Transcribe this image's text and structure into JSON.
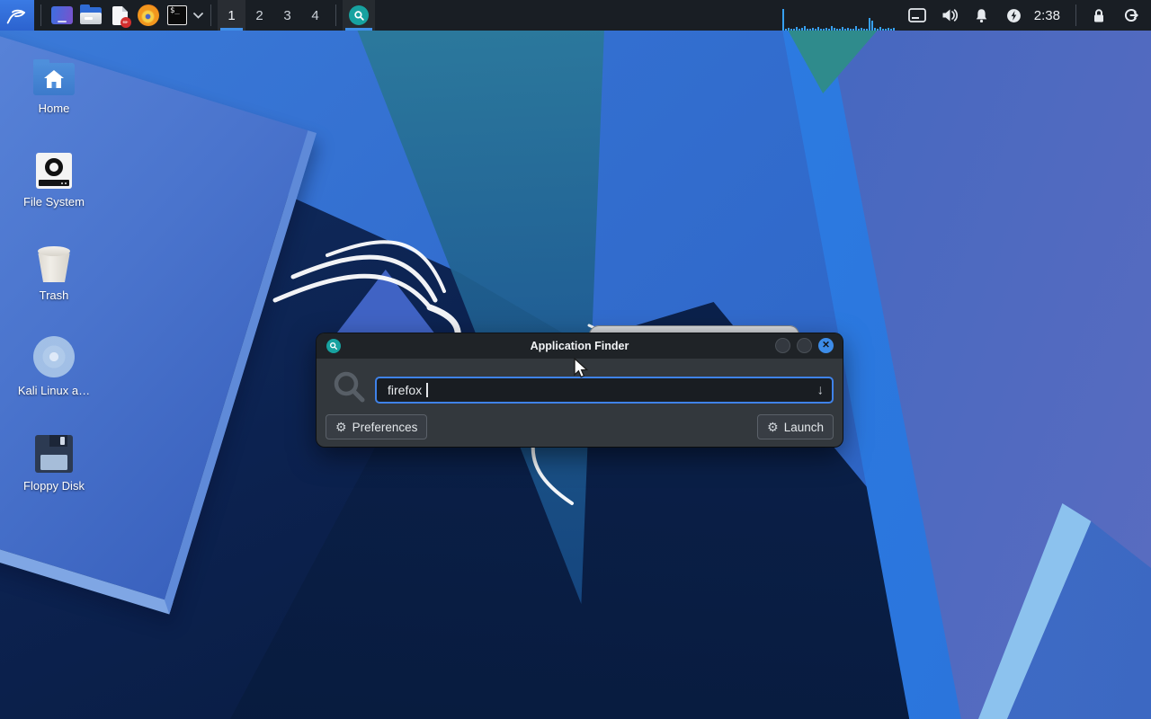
{
  "panel": {
    "colors": {
      "accent": "#3f8fe8",
      "panel_bg": "#191e24",
      "kali_blue": "#2c63cf"
    },
    "menu": {
      "icon": "kali-dragon-icon"
    },
    "launcher_icons": [
      "desktop-icon",
      "file-manager-icon",
      "text-editor-icon",
      "firefox-icon",
      "terminal-icon"
    ],
    "terminal_dropdown_icon": "chevron-down-icon",
    "workspaces": {
      "items": [
        "1",
        "2",
        "3",
        "4"
      ],
      "active": "1"
    },
    "taskbar": {
      "app": "application-finder",
      "icon": "app-finder-icon"
    },
    "cpu_graph_bars": [
      24,
      2,
      3,
      2,
      2,
      4,
      2,
      3,
      5,
      2,
      2,
      3,
      2,
      4,
      2,
      2,
      3,
      2,
      5,
      3,
      2,
      2,
      4,
      2,
      3,
      2,
      2,
      5,
      2,
      3,
      2,
      2,
      14,
      11,
      3,
      2,
      4,
      2,
      2,
      3,
      2,
      3
    ],
    "tray_icons": [
      "touchpad-icon",
      "volume-icon",
      "notification-bell-icon",
      "power-manager-icon"
    ],
    "clock": "2:38",
    "session_icons": [
      "lock-icon",
      "logout-icon"
    ]
  },
  "desktop_icons": [
    {
      "label": "Home",
      "icon": "home-folder-icon"
    },
    {
      "label": "File System",
      "icon": "drive-icon"
    },
    {
      "label": "Trash",
      "icon": "trash-icon"
    },
    {
      "label": "Kali Linux a…",
      "icon": "cdrom-icon"
    },
    {
      "label": "Floppy Disk",
      "icon": "floppy-icon"
    }
  ],
  "window_finder": {
    "title": "Application Finder",
    "search_value": "firefox",
    "input_arrow": "↓",
    "buttons": {
      "preferences": "Preferences",
      "launch": "Launch"
    },
    "window_controls": [
      "minimize",
      "maximize",
      "close"
    ],
    "close_glyph": "✕"
  }
}
